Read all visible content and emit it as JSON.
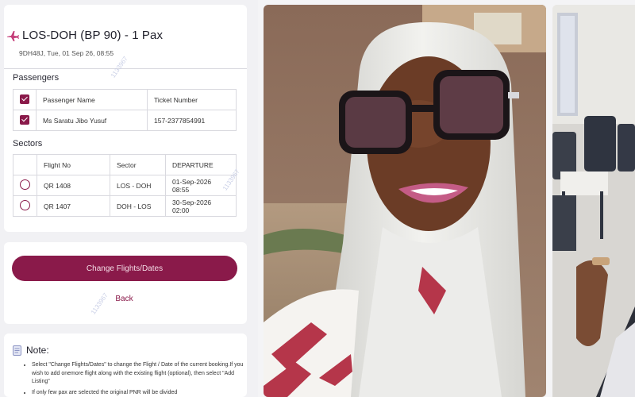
{
  "booking": {
    "route_title": "LOS-DOH (BP 90) - 1 Pax",
    "subtitle": "9DH48J, Tue, 01 Sep 26, 08:55",
    "passengers_label": "Passengers",
    "passenger_headers": [
      "Passenger Name",
      "Ticket Number"
    ],
    "passengers": [
      {
        "name": "Ms Saratu Jibo Yusuf",
        "ticket": "157-2377854991",
        "checked": true
      }
    ],
    "sectors_label": "Sectors",
    "sector_headers": [
      "Flight No",
      "Sector",
      "DEPARTURE"
    ],
    "sectors": [
      {
        "flight": "QR 1408",
        "sector": "LOS - DOH",
        "departure": "01-Sep-2026 08:55"
      },
      {
        "flight": "QR 1407",
        "sector": "DOH - LOS",
        "departure": "30-Sep-2026 02:00"
      }
    ]
  },
  "actions": {
    "change_label": "Change Flights/Dates",
    "back_label": "Back"
  },
  "note": {
    "title": "Note:",
    "items": [
      "Select \"Change Flights/Dates\" to change the Flight / Date of the current booking.If you wish to add onemore flight along with the existing flight (optional), then select \"Add Listing\"",
      "If only few pax are selected the original PNR will be divided"
    ]
  },
  "watermark": "1133967",
  "colors": {
    "accent": "#8a1a4a",
    "panel_bg": "#f1f1f4",
    "card_bg": "#ffffff"
  },
  "icons": {
    "route": "plane-icon",
    "checkbox": "checkbox-checked-icon",
    "radio": "radio-unchecked-icon",
    "note": "document-icon"
  }
}
